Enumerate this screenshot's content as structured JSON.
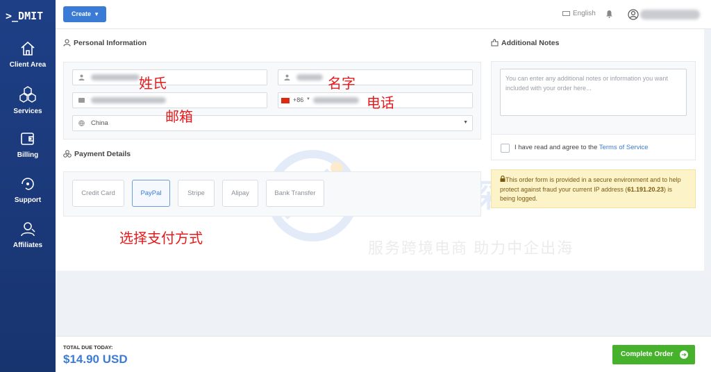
{
  "sidebar": {
    "logo": ">_DMIT",
    "items": [
      {
        "label": "Client Area",
        "icon": "home-icon"
      },
      {
        "label": "Services",
        "icon": "cubes-icon"
      },
      {
        "label": "Billing",
        "icon": "wallet-icon"
      },
      {
        "label": "Support",
        "icon": "support-icon"
      },
      {
        "label": "Affiliates",
        "icon": "users-icon"
      }
    ]
  },
  "topbar": {
    "create_label": "Create",
    "language": "English"
  },
  "personal": {
    "title": "Personal Information",
    "country_code": "+86",
    "country": "China"
  },
  "annotations": {
    "surname": "姓氏",
    "given_name": "名字",
    "email": "邮箱",
    "phone": "电话",
    "payment": "选择支付方式"
  },
  "payment": {
    "title": "Payment Details",
    "methods": [
      "Credit Card",
      "PayPal",
      "Stripe",
      "Alipay",
      "Bank Transfer"
    ],
    "selected": "PayPal"
  },
  "notes": {
    "title": "Additional Notes",
    "placeholder": "You can enter any additional notes or information you want included with your order here..."
  },
  "tos": {
    "prefix": "I have read and agree to the",
    "link": "Terms of Service"
  },
  "secure": {
    "text1": "This order form is provided in a secure environment and to help protect against fraud your current IP address (",
    "ip": "61.191.20.23",
    "text2": ") is being logged."
  },
  "watermark": {
    "title": "主机侦探",
    "subtitle": "服务跨境电商 助力中企出海"
  },
  "footer": {
    "total_label": "TOTAL DUE TODAY:",
    "total": "$14.90 USD",
    "complete_label": "Complete Order"
  },
  "colors": {
    "sidebar": "#1e3f86",
    "accent": "#3a7bd5",
    "complete": "#46b12b",
    "annotation": "#e8191b",
    "warning_bg": "#fcf3c9"
  }
}
